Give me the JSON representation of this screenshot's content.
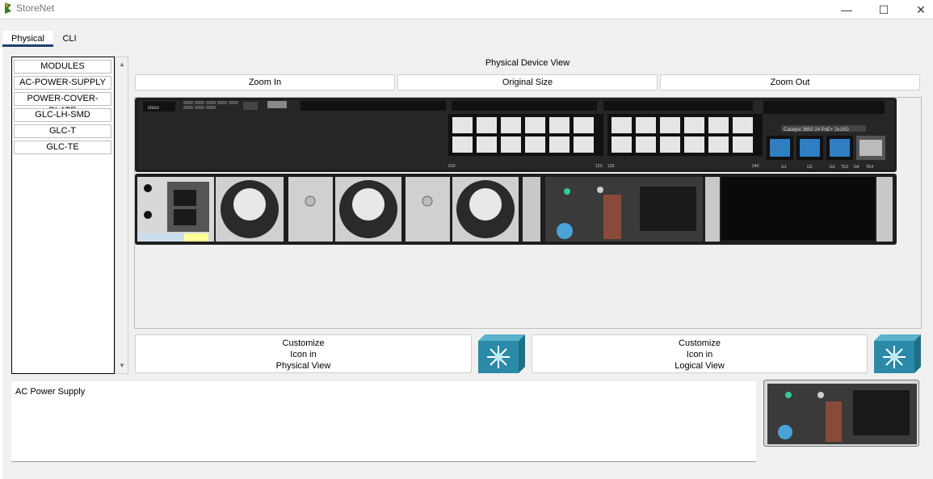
{
  "window": {
    "title": "StoreNet",
    "minimize_glyph": "—",
    "maximize_glyph": "☐",
    "close_glyph": "✕"
  },
  "tabs": [
    {
      "label": "Physical",
      "active": true
    },
    {
      "label": "CLI",
      "active": false
    }
  ],
  "modules": {
    "items": [
      {
        "label": "MODULES"
      },
      {
        "label": "AC-POWER-SUPPLY"
      },
      {
        "label": "POWER-COVER-PLATE"
      },
      {
        "label": "GLC-LH-SMD"
      },
      {
        "label": "GLC-T"
      },
      {
        "label": "GLC-TE"
      }
    ]
  },
  "view": {
    "title": "Physical Device View",
    "zoom_in_label": "Zoom In",
    "original_size_label": "Original Size",
    "zoom_out_label": "Zoom Out"
  },
  "device": {
    "model_label": "Catalyst 3650 24 PoE+ 2x10G",
    "brand": "cisco",
    "port_range_left": [
      "01X",
      "12X"
    ],
    "port_range_right": [
      "13X",
      "24X"
    ],
    "uplink_labels": [
      "G1",
      "G2",
      "G3",
      "TE3",
      "G4",
      "TE4"
    ]
  },
  "customize": {
    "physical_lines": [
      "Customize",
      "Icon in",
      "Physical View"
    ],
    "logical_lines": [
      "Customize",
      "Icon in",
      "Logical View"
    ]
  },
  "description": {
    "text": "AC Power Supply"
  },
  "colors": {
    "tab_underline": "#1f3f6e",
    "chassis": "#1e1e1e",
    "icon_teal": "#2a8aa8"
  },
  "icons": {
    "app": "packet-tracer-icon",
    "switch": "multilayer-switch-icon"
  }
}
